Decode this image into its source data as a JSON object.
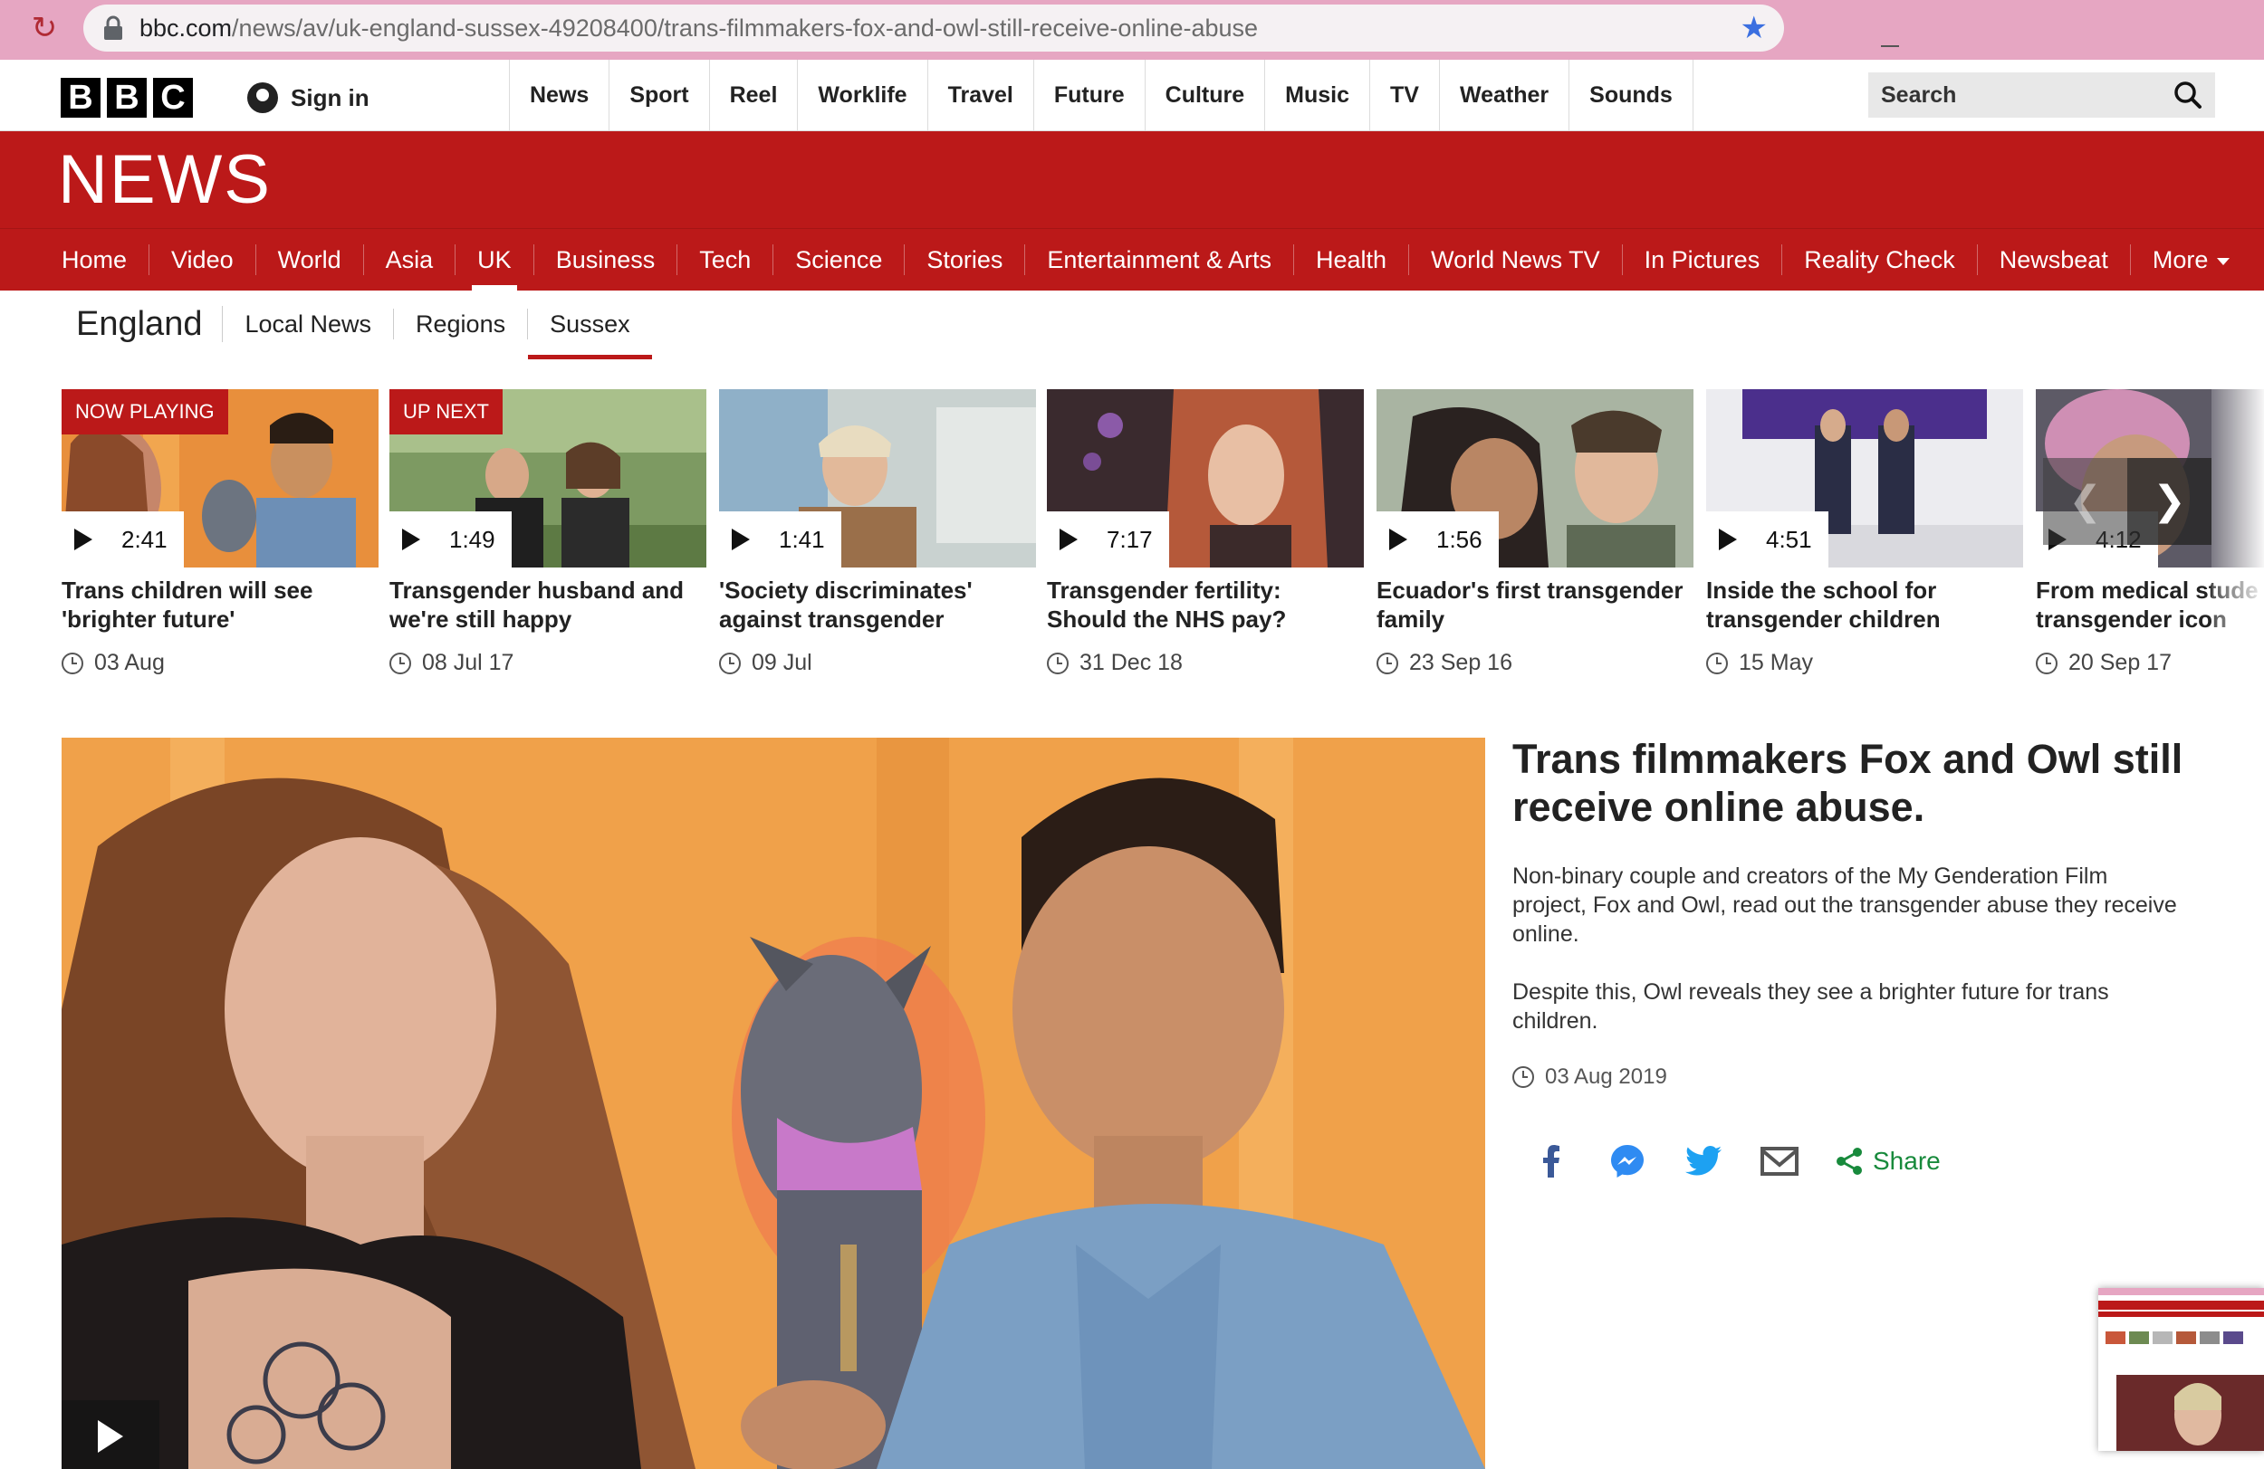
{
  "browser": {
    "url_domain": "bbc.com",
    "url_path": "/news/av/uk-england-sussex-49208400/trans-filmmakers-fox-and-owl-still-receive-online-abuse",
    "icons": [
      "reload-icon",
      "lock-icon",
      "bookmark-star-icon"
    ]
  },
  "masthead": {
    "logo": [
      "B",
      "B",
      "C"
    ],
    "signin_label": "Sign in",
    "nav": [
      "News",
      "Sport",
      "Reel",
      "Worklife",
      "Travel",
      "Future",
      "Culture",
      "Music",
      "TV",
      "Weather",
      "Sounds"
    ],
    "search_placeholder": "Search"
  },
  "banner": {
    "title": "NEWS"
  },
  "section_nav": {
    "items": [
      "Home",
      "Video",
      "World",
      "Asia",
      "UK",
      "Business",
      "Tech",
      "Science",
      "Stories",
      "Entertainment & Arts",
      "Health",
      "World News TV",
      "In Pictures",
      "Reality Check",
      "Newsbeat",
      "More"
    ],
    "active": "UK"
  },
  "sub_nav": {
    "region": "England",
    "items": [
      "Local News",
      "Regions",
      "Sussex"
    ],
    "active": "Sussex"
  },
  "carousel": {
    "cards": [
      {
        "tag": "NOW PLAYING",
        "duration": "2:41",
        "title": "Trans children will see 'brighter future'",
        "date": "03 Aug"
      },
      {
        "tag": "UP NEXT",
        "duration": "1:49",
        "title": "Transgender husband and we're still happy",
        "date": "08 Jul 17"
      },
      {
        "tag": "",
        "duration": "1:41",
        "title": "'Society discriminates' against transgender",
        "date": "09 Jul"
      },
      {
        "tag": "",
        "duration": "7:17",
        "title": "Transgender fertility: Should the NHS pay?",
        "date": "31 Dec 18"
      },
      {
        "tag": "",
        "duration": "1:56",
        "title": "Ecuador's first transgender family",
        "date": "23 Sep 16"
      },
      {
        "tag": "",
        "duration": "4:51",
        "title": "Inside the school for transgender children",
        "date": "15 May"
      },
      {
        "tag": "",
        "duration": "4:12",
        "title": "From medical stude transgender icon",
        "date": "20 Sep 17"
      }
    ],
    "prev_glyph": "❮",
    "next_glyph": "❯"
  },
  "article": {
    "headline": "Trans filmmakers Fox and Owl still receive online abuse.",
    "paragraph1": "Non-binary couple and creators of the My Genderation Film project, Fox and Owl, read out the transgender abuse they receive online.",
    "paragraph2": "Despite this, Owl reveals they see a brighter future for trans children.",
    "date": "03 Aug 2019",
    "share_label": "Share"
  },
  "colors": {
    "bbc_red": "#bb1919",
    "share_green": "#188a3c",
    "facebook": "#3b5998",
    "messenger": "#2f8bf2",
    "twitter": "#1da1f2"
  }
}
